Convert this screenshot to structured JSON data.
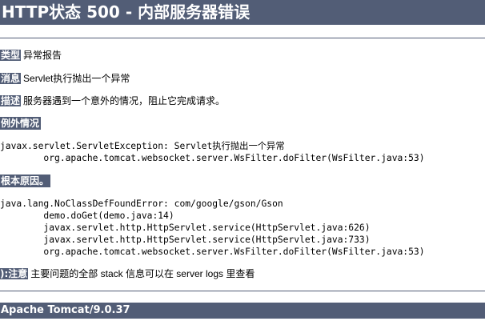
{
  "title": "HTTP状态 500 - 内部服务器错误",
  "fields": {
    "type": {
      "label": "类型",
      "value": "异常报告"
    },
    "message": {
      "label": "消息",
      "value": "Servlet执行抛出一个异常"
    },
    "description": {
      "label": "描述",
      "value": "服务器遇到一个意外的情况，阻止它完成请求。"
    }
  },
  "exception": {
    "label": "例外情况",
    "lines": [
      "javax.servlet.ServletException: Servlet执行抛出一个异常",
      "\torg.apache.tomcat.websocket.server.WsFilter.doFilter(WsFilter.java:53)"
    ]
  },
  "root_cause": {
    "label": "根本原因。",
    "lines": [
      "java.lang.NoClassDefFoundError: com/google/gson/Gson",
      "\tdemo.doGet(demo.java:14)",
      "\tjavax.servlet.http.HttpServlet.service(HttpServlet.java:626)",
      "\tjavax.servlet.http.HttpServlet.service(HttpServlet.java:733)",
      "\torg.apache.tomcat.websocket.server.WsFilter.doFilter(WsFilter.java:53)"
    ]
  },
  "note": {
    "label": "):注意",
    "value": "主要问题的全部 stack 信息可以在 server logs 里查看"
  },
  "footer": "Apache Tomcat/9.0.37",
  "colors": {
    "header_bg": "#525d76",
    "header_text": "#ffffff"
  }
}
